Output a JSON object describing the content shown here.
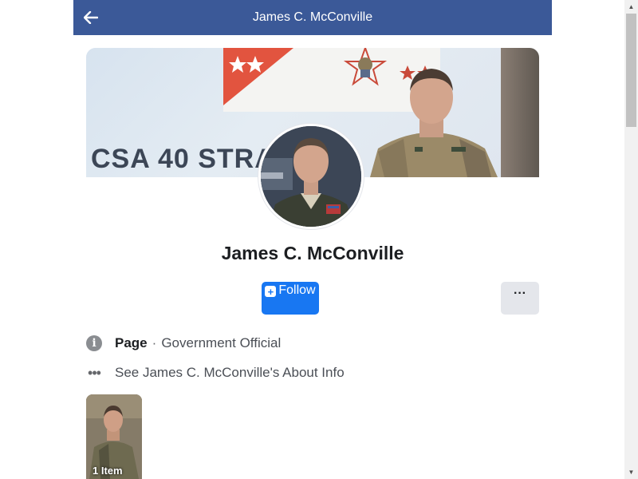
{
  "header": {
    "title": "James C. McConville",
    "back_icon": "arrow-left-icon"
  },
  "cover": {
    "slide_text": "CSA 40 STRAT"
  },
  "profile": {
    "name": "James C. McConville",
    "follow_label": "Follow",
    "more_label": "···"
  },
  "info": {
    "page_label": "Page",
    "separator": "·",
    "category": "Government Official",
    "about_link": "See James C. McConville's About Info"
  },
  "album": {
    "count_label": "1 Item"
  },
  "colors": {
    "header_bg": "#3b5998",
    "follow_bg": "#1877f2",
    "more_bg": "#e4e6eb"
  }
}
